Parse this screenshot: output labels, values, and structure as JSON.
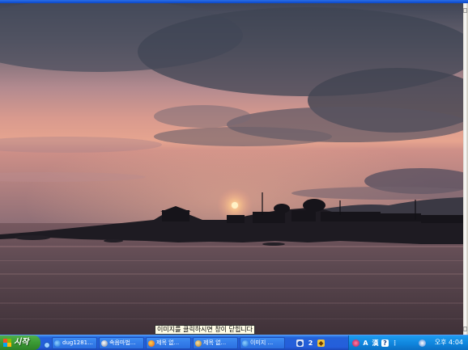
{
  "caption": {
    "text": "이미지를 클릭하시면 창이 닫힙니다"
  },
  "taskbar": {
    "start_label": "시작",
    "tasks": [
      {
        "label": "dug1281...",
        "icon": "ie-icon"
      },
      {
        "label": "속음마법...",
        "icon": "magnifier-icon"
      },
      {
        "label": "제목 없...",
        "icon": "firefox-icon"
      },
      {
        "label": "제목 없...",
        "icon": "notepad-icon"
      },
      {
        "label": "이미지 ...",
        "icon": "ie-icon"
      }
    ],
    "tray": {
      "badge_number": "2",
      "ime_letter": "A",
      "ime_hanja": "漢",
      "help_mark": "?"
    },
    "clock": "오후 4:04"
  },
  "colors": {
    "taskbar_blue": "#245edb",
    "start_green": "#3b9a34",
    "notify_blue": "#0f84dc",
    "sky_top": "#4e5463",
    "sky_glow": "#e7a390",
    "sun": "#fff2c6",
    "sea": "#4a3e44"
  }
}
